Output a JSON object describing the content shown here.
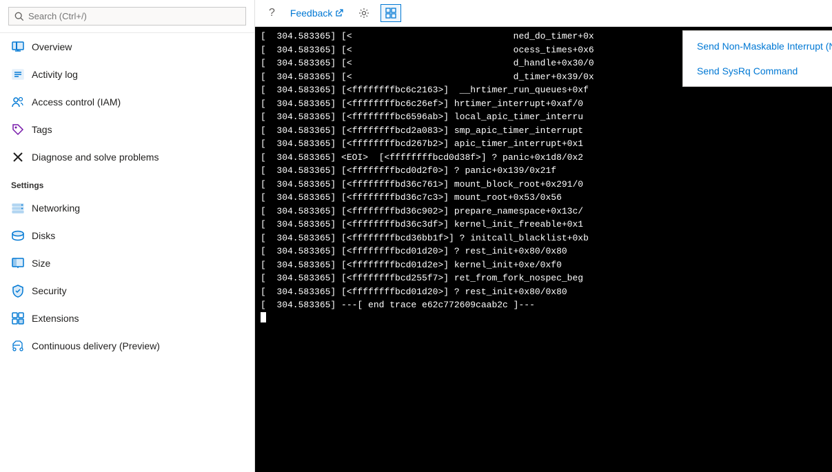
{
  "sidebar": {
    "search_placeholder": "Search (Ctrl+/)",
    "nav_items": [
      {
        "id": "overview",
        "label": "Overview",
        "icon": "monitor-icon",
        "icon_color": "#0078d4"
      },
      {
        "id": "activity-log",
        "label": "Activity log",
        "icon": "list-icon",
        "icon_color": "#0078d4"
      },
      {
        "id": "access-control",
        "label": "Access control (IAM)",
        "icon": "people-icon",
        "icon_color": "#0078d4"
      },
      {
        "id": "tags",
        "label": "Tags",
        "icon": "tag-icon",
        "icon_color": "#7719aa"
      },
      {
        "id": "diagnose",
        "label": "Diagnose and solve problems",
        "icon": "x-icon",
        "icon_color": "#201f1e"
      }
    ],
    "settings_header": "Settings",
    "settings_items": [
      {
        "id": "networking",
        "label": "Networking",
        "icon": "networking-icon",
        "icon_color": "#0078d4"
      },
      {
        "id": "disks",
        "label": "Disks",
        "icon": "disks-icon",
        "icon_color": "#0078d4"
      },
      {
        "id": "size",
        "label": "Size",
        "icon": "size-icon",
        "icon_color": "#0078d4"
      },
      {
        "id": "security",
        "label": "Security",
        "icon": "security-icon",
        "icon_color": "#0078d4"
      },
      {
        "id": "extensions",
        "label": "Extensions",
        "icon": "extensions-icon",
        "icon_color": "#0078d4"
      },
      {
        "id": "continuous-delivery",
        "label": "Continuous delivery (Preview)",
        "icon": "delivery-icon",
        "icon_color": "#0078d4"
      }
    ]
  },
  "toolbar": {
    "help_label": "?",
    "feedback_label": "Feedback",
    "settings_title": "Settings",
    "grid_title": "Grid"
  },
  "dropdown": {
    "items": [
      {
        "id": "nmi",
        "label": "Send Non-Maskable Interrupt (NMI)"
      },
      {
        "id": "sysrq",
        "label": "Send SysRq Command"
      }
    ]
  },
  "terminal": {
    "lines": [
      "[  304.583365] [<                              ned_do_timer+0x",
      "[  304.583365] [<                              ocess_times+0x6",
      "[  304.583365] [<                              d_handle+0x30/0",
      "[  304.583365] [<                              d_timer+0x39/0x",
      "[  304.583365] [<ffffffffbc6c2163>]  __hrtimer_run_queues+0xf",
      "[  304.583365] [<ffffffffbc6c26ef>] hrtimer_interrupt+0xaf/0",
      "[  304.583365] [<ffffffffbc6596ab>] local_apic_timer_interru",
      "[  304.583365] [<ffffffffbcd2a083>] smp_apic_timer_interrupt",
      "[  304.583365] [<ffffffffbcd267b2>] apic_timer_interrupt+0x1",
      "[  304.583365] <EOI>  [<ffffffffbcd0d38f>] ? panic+0x1d8/0x2",
      "[  304.583365] [<ffffffffbcd0d2f0>] ? panic+0x139/0x21f",
      "[  304.583365] [<ffffffffbd36c761>] mount_block_root+0x291/0",
      "[  304.583365] [<ffffffffbd36c7c3>] mount_root+0x53/0x56",
      "[  304.583365] [<ffffffffbd36c902>] prepare_namespace+0x13c/",
      "[  304.583365] [<ffffffffbd36c3df>] kernel_init_freeable+0x1",
      "[  304.583365] [<ffffffffbcd36bb1f>] ? initcall_blacklist+0xb",
      "[  304.583365] [<ffffffffbcd01d20>] ? rest_init+0x80/0x80",
      "[  304.583365] [<ffffffffbcd01d2e>] kernel_init+0xe/0xf0",
      "[  304.583365] [<ffffffffbcd255f7>] ret_from_fork_nospec_beg",
      "[  304.583365] [<ffffffffbcd01d20>] ? rest_init+0x80/0x80",
      "[  304.583365] ---[ end trace e62c772609caab2c ]---"
    ],
    "cursor_line": ""
  },
  "colors": {
    "accent": "#0078d4",
    "terminal_bg": "#000000",
    "terminal_text": "#ffffff",
    "sidebar_bg": "#ffffff",
    "dropdown_bg": "#ffffff"
  }
}
